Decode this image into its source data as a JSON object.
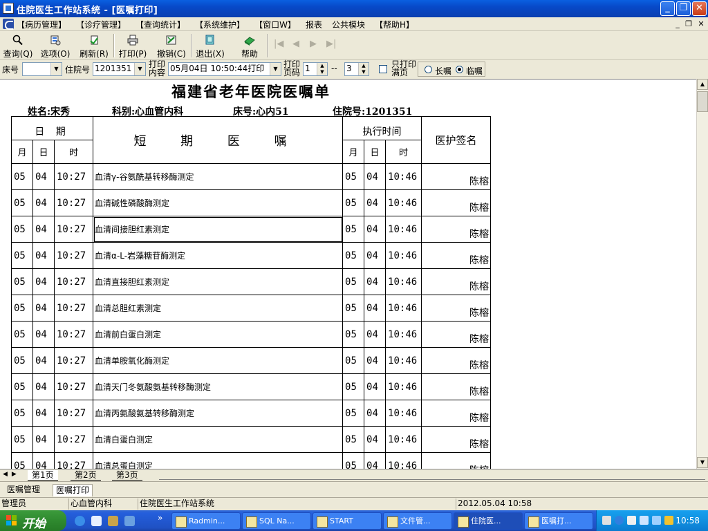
{
  "window": {
    "title": "住院医生工作站系统 - [医嘱打印]",
    "minimize": "_",
    "maximize": "❐",
    "close": "✕"
  },
  "menu": {
    "items": [
      "【病历管理】",
      "【诊疗管理】",
      "【查询统计】",
      "【系统维护】",
      "【窗口W】",
      "报表",
      "公共模块",
      "【帮助H】"
    ],
    "mdi_min": "_",
    "mdi_restore": "❐",
    "mdi_close": "✕"
  },
  "toolbar": {
    "query": "查询(Q)",
    "options": "选项(O)",
    "refresh": "刷新(R)",
    "print": "打印(P)",
    "undo": "撤销(C)",
    "exit": "退出(X)",
    "help": "帮助",
    "nav_first": "|◀",
    "nav_prev": "◀",
    "nav_next": "▶",
    "nav_last": "▶|"
  },
  "filter": {
    "bed_label": "床号",
    "bed_value": "",
    "admission_label": "住院号",
    "admission_value": "1201351",
    "print_content_label_1": "打印",
    "print_content_label_2": "内容",
    "print_content_value": "05月04日 10:50:44打印",
    "page_label_1": "打印",
    "page_label_2": "页码",
    "page_from": "1",
    "page_sep": "--",
    "page_to": "3",
    "only_print_label_1": "只打印",
    "only_print_label_2": "满页",
    "radio_long": "长嘱",
    "radio_temp": "临嘱"
  },
  "document": {
    "title": "福建省老年医院医嘱单",
    "name": "姓名:宋秀",
    "dept": "科别:心血管内科",
    "bed": "床号:心内51",
    "admission": "住院号:1201351",
    "headers": {
      "date": "日 期",
      "month": "月",
      "day": "日",
      "time": "时",
      "order": "短 期 医 嘱",
      "exec_time": "执行时间",
      "exec_month": "月",
      "exec_day": "日",
      "exec_hour": "时",
      "signature": "医护签名"
    },
    "rows": [
      {
        "m": "05",
        "d": "04",
        "t": "10:27",
        "item": "血清γ-谷氨酰基转移酶测定",
        "em": "05",
        "ed": "04",
        "et": "10:46",
        "sign": "陈榕"
      },
      {
        "m": "05",
        "d": "04",
        "t": "10:27",
        "item": "血清碱性磷酸酶测定",
        "em": "05",
        "ed": "04",
        "et": "10:46",
        "sign": "陈榕"
      },
      {
        "m": "05",
        "d": "04",
        "t": "10:27",
        "item": "血清间接胆红素测定",
        "em": "05",
        "ed": "04",
        "et": "10:46",
        "sign": "陈榕"
      },
      {
        "m": "05",
        "d": "04",
        "t": "10:27",
        "item": "血清α-L-岩藻糖苷酶测定",
        "em": "05",
        "ed": "04",
        "et": "10:46",
        "sign": "陈榕"
      },
      {
        "m": "05",
        "d": "04",
        "t": "10:27",
        "item": "血清直接胆红素测定",
        "em": "05",
        "ed": "04",
        "et": "10:46",
        "sign": "陈榕"
      },
      {
        "m": "05",
        "d": "04",
        "t": "10:27",
        "item": "血清总胆红素测定",
        "em": "05",
        "ed": "04",
        "et": "10:46",
        "sign": "陈榕"
      },
      {
        "m": "05",
        "d": "04",
        "t": "10:27",
        "item": "血清前白蛋白测定",
        "em": "05",
        "ed": "04",
        "et": "10:46",
        "sign": "陈榕"
      },
      {
        "m": "05",
        "d": "04",
        "t": "10:27",
        "item": "血清单胺氧化酶测定",
        "em": "05",
        "ed": "04",
        "et": "10:46",
        "sign": "陈榕"
      },
      {
        "m": "05",
        "d": "04",
        "t": "10:27",
        "item": "血清天门冬氨酸氨基转移酶测定",
        "em": "05",
        "ed": "04",
        "et": "10:46",
        "sign": "陈榕"
      },
      {
        "m": "05",
        "d": "04",
        "t": "10:27",
        "item": "血清丙氨酸氨基转移酶测定",
        "em": "05",
        "ed": "04",
        "et": "10:46",
        "sign": "陈榕"
      },
      {
        "m": "05",
        "d": "04",
        "t": "10:27",
        "item": "血清白蛋白测定",
        "em": "05",
        "ed": "04",
        "et": "10:46",
        "sign": "陈榕"
      },
      {
        "m": "05",
        "d": "04",
        "t": "10:27",
        "item": "血清总蛋白测定",
        "em": "05",
        "ed": "04",
        "et": "10:46",
        "sign": "陈榕"
      }
    ]
  },
  "page_tabs": [
    "第1页",
    "第2页",
    "第3页"
  ],
  "module_tabs": [
    "医嘱管理",
    "医嘱打印"
  ],
  "status": {
    "user": "管理员",
    "dept": "心血管内科",
    "system": "住院医生工作站系统",
    "datetime": "2012.05.04 10:58"
  },
  "taskbar": {
    "start": "开始",
    "more": "»",
    "tasks": [
      "Radmin...",
      "SQL Na...",
      "START",
      "文件管...",
      "住院医...",
      "医嘱打..."
    ],
    "clock": "10:58"
  }
}
